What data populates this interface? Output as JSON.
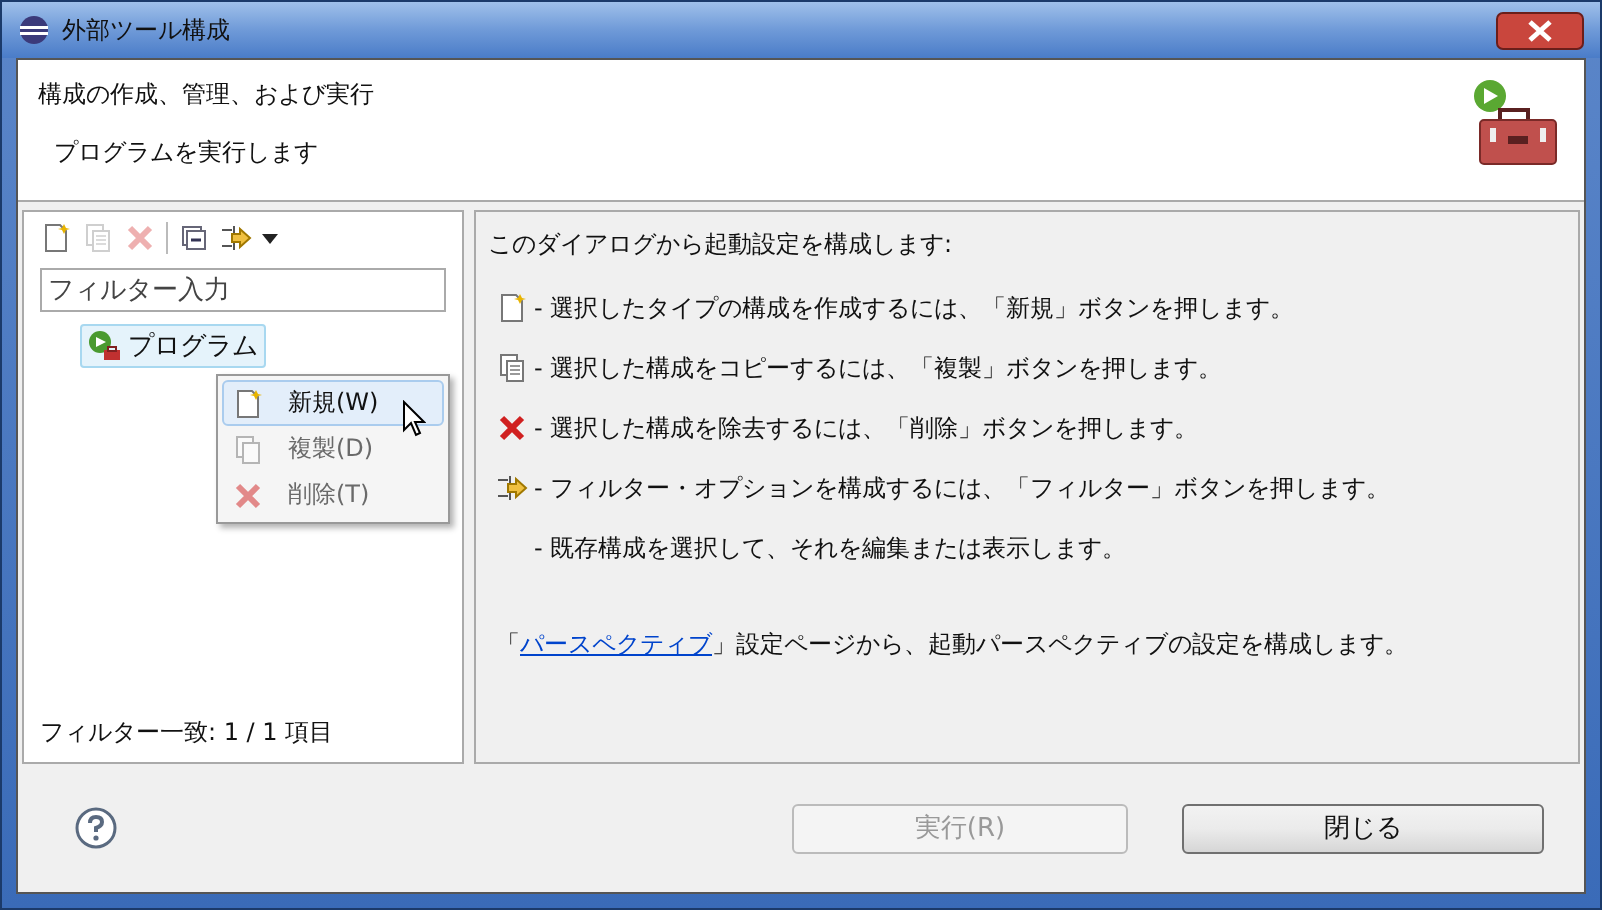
{
  "window": {
    "title": "外部ツール構成"
  },
  "header": {
    "title": "構成の作成、管理、および実行",
    "message": "プログラムを実行します"
  },
  "toolbar": [
    {
      "kind": "new",
      "disabled": false
    },
    {
      "kind": "copy",
      "disabled": true
    },
    {
      "kind": "delete",
      "disabled": true
    },
    {
      "kind": "collapse",
      "disabled": false
    },
    {
      "kind": "filter",
      "disabled": false
    },
    {
      "kind": "dropdown",
      "disabled": false
    }
  ],
  "filter": {
    "placeholder": "フィルター入力"
  },
  "tree": [
    {
      "label": "プログラム",
      "selected": true
    }
  ],
  "context_menu": [
    {
      "kind": "new",
      "label": "新規(W)",
      "disabled": false,
      "selected": true
    },
    {
      "kind": "copy",
      "label": "複製(D)",
      "disabled": true,
      "selected": false
    },
    {
      "kind": "delete",
      "label": "削除(T)",
      "disabled": true,
      "selected": false
    }
  ],
  "filter_status": "フィルター一致: 1 / 1 項目",
  "description": {
    "intro": "このダイアログから起動設定を構成します:",
    "items": [
      {
        "kind": "new",
        "text": "- 選択したタイプの構成を作成するには、「新規」ボタンを押します。"
      },
      {
        "kind": "copy",
        "text": "- 選択した構成をコピーするには、「複製」ボタンを押します。"
      },
      {
        "kind": "delete",
        "text": "- 選択した構成を除去するには、「削除」ボタンを押します。"
      },
      {
        "kind": "filter",
        "text": "- フィルター・オプションを構成するには、「フィルター」ボタンを押します。"
      },
      {
        "kind": "none",
        "text": "- 既存構成を選択して、それを編集または表示します。"
      }
    ],
    "link_prefix": "「",
    "link": "パースペクティブ",
    "link_suffix": "」設定ページから、起動パースペクティブの設定を構成します。"
  },
  "buttons": [
    {
      "label": "実行(R)",
      "disabled": true
    },
    {
      "label": "閉じる",
      "disabled": false
    }
  ]
}
